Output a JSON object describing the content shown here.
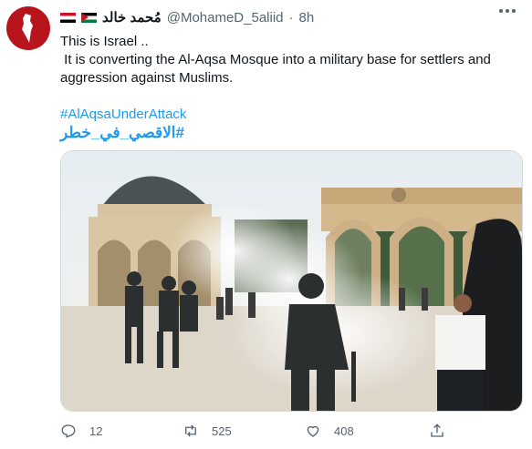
{
  "tweet": {
    "display_name": "مُحمد خالد",
    "handle": "@MohameD_5aliid",
    "separator": "·",
    "time": "8h",
    "lines": [
      "This is Israel ..",
      " It is converting the Al-Aqsa Mosque into a military base for settlers and",
      "aggression against Muslims."
    ],
    "hashtags": [
      "#AlAqsaUnderAttack",
      "#الاقصي_في_خطر"
    ],
    "image_description_icon": "photo"
  },
  "stats": {
    "replies": "12",
    "retweets": "525",
    "likes": "408"
  },
  "icons": {
    "avatar": "palestine-map-logo-icon",
    "reply": "reply-icon",
    "retweet": "retweet-icon",
    "like": "heart-icon",
    "share": "share-icon",
    "more": "more-icon"
  },
  "colors": {
    "link": "#1d9bf0",
    "muted": "#536471",
    "avatar_bg": "#b8141c"
  }
}
